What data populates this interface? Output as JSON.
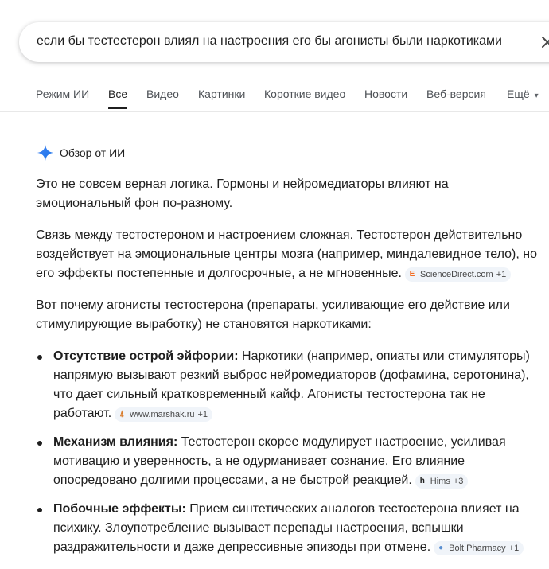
{
  "search": {
    "query": "если бы тестестерон влиял на настроения его бы агонисты были наркотиками"
  },
  "tabs": [
    {
      "label": "Режим ИИ"
    },
    {
      "label": "Все"
    },
    {
      "label": "Видео"
    },
    {
      "label": "Картинки"
    },
    {
      "label": "Короткие видео"
    },
    {
      "label": "Новости"
    },
    {
      "label": "Веб-версия"
    },
    {
      "label": "Ещё"
    }
  ],
  "ai_overview": {
    "title": "Обзор от ИИ",
    "intro": "Это не совсем верная логика. Гормоны и нейромедиаторы влияют на эмоциональный фон по-разному.",
    "para2": "Связь между тестостероном и настроением сложная. Тестостерон действительно воздействует на эмоциональные центры мозга (например, миндалевидное тело), но его эффекты постепенные и долгосрочные, а не мгновенные.",
    "para2_source": {
      "name": "ScienceDirect.com",
      "count": "+1"
    },
    "para3": "Вот почему агонисты тестостерона (препараты, усиливающие его действие или стимулирующие выработку) не становятся наркотиками:",
    "bullets": [
      {
        "title": "Отсутствие острой эйфории:",
        "text": " Наркотики (например, опиаты или стимуляторы) напрямую вызывают резкий выброс нейромедиаторов (дофамина, серотонина), что дает сильный кратковременный кайф. Агонисты тестостерона так не работают.",
        "source": {
          "name": "www.marshak.ru",
          "count": "+1"
        }
      },
      {
        "title": "Механизм влияния:",
        "text": " Тестостерон скорее модулирует настроение, усиливая мотивацию и уверенность, а не одурманивает сознание. Его влияние опосредовано долгими процессами, а не быстрой реакцией.",
        "source": {
          "name": "Hims",
          "count": "+3"
        }
      },
      {
        "title": "Побочные эффекты:",
        "text": " Прием синтетических аналогов тестостерона влияет на психику. Злоупотребление вызывает перепады настроения, вспышки раздражительности и даже депрессивные эпизоды при отмене.",
        "source": {
          "name": "Bolt Pharmacy",
          "count": "+1"
        }
      }
    ]
  }
}
